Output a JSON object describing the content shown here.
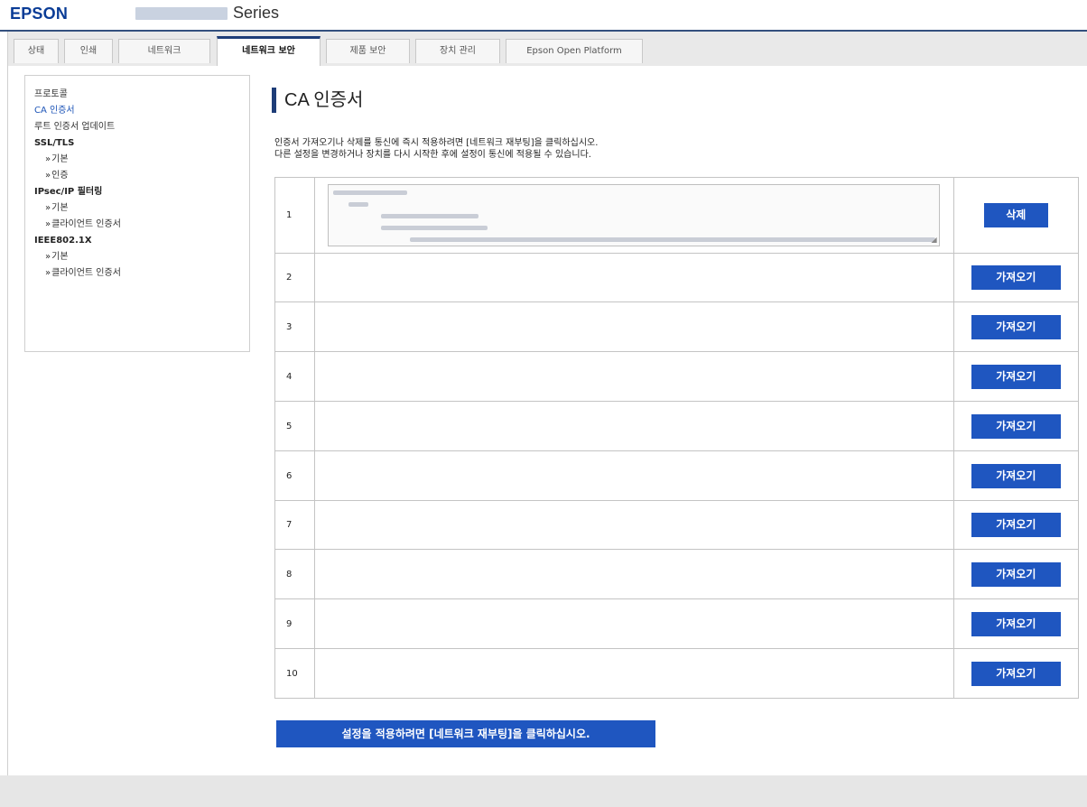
{
  "header": {
    "brand": "EPSON",
    "series": "Series"
  },
  "tabs": [
    {
      "label": "상태",
      "active": false
    },
    {
      "label": "인쇄",
      "active": false
    },
    {
      "label": "네트워크",
      "active": false
    },
    {
      "label": "네트워크 보안",
      "active": true
    },
    {
      "label": "제품 보안",
      "active": false
    },
    {
      "label": "장치 관리",
      "active": false
    },
    {
      "label": "Epson Open Platform",
      "active": false
    }
  ],
  "sidebar": {
    "items": [
      {
        "label": "프로토콜",
        "type": "link"
      },
      {
        "label": "CA 인증서",
        "type": "link",
        "active": true
      },
      {
        "label": "루트 인증서 업데이트",
        "type": "link"
      },
      {
        "label": "SSL/TLS",
        "type": "section"
      },
      {
        "label": "기본",
        "type": "sub"
      },
      {
        "label": "인증",
        "type": "sub"
      },
      {
        "label": "IPsec/IP 필터링",
        "type": "section"
      },
      {
        "label": "기본",
        "type": "sub"
      },
      {
        "label": "클라이언트 인증서",
        "type": "sub"
      },
      {
        "label": "IEEE802.1X",
        "type": "section"
      },
      {
        "label": "기본",
        "type": "sub"
      },
      {
        "label": "클라이언트 인증서",
        "type": "sub"
      }
    ]
  },
  "main": {
    "title": "CA 인증서",
    "description_line1": "인증서 가져오기나 삭제를 통신에 즉시 적용하려면 [네트워크 재부팅]을 클릭하십시오.",
    "description_line2": "다른 설정을 변경하거나 장치를 다시 시작한 후에 설정이 통신에 적용될 수 있습니다.",
    "certificates": [
      {
        "number": "1",
        "action": "삭제"
      },
      {
        "number": "2",
        "action": "가져오기"
      },
      {
        "number": "3",
        "action": "가져오기"
      },
      {
        "number": "4",
        "action": "가져오기"
      },
      {
        "number": "5",
        "action": "가져오기"
      },
      {
        "number": "6",
        "action": "가져오기"
      },
      {
        "number": "7",
        "action": "가져오기"
      },
      {
        "number": "8",
        "action": "가져오기"
      },
      {
        "number": "9",
        "action": "가져오기"
      },
      {
        "number": "10",
        "action": "가져오기"
      }
    ],
    "apply_banner": "설정을 적용하려면 [네트워크 재부팅]을 클릭하십시오."
  },
  "colors": {
    "brand": "#0a3c96",
    "accent": "#1f56c0",
    "active_link": "#1f56b8",
    "title_bar": "#1e3d78"
  }
}
